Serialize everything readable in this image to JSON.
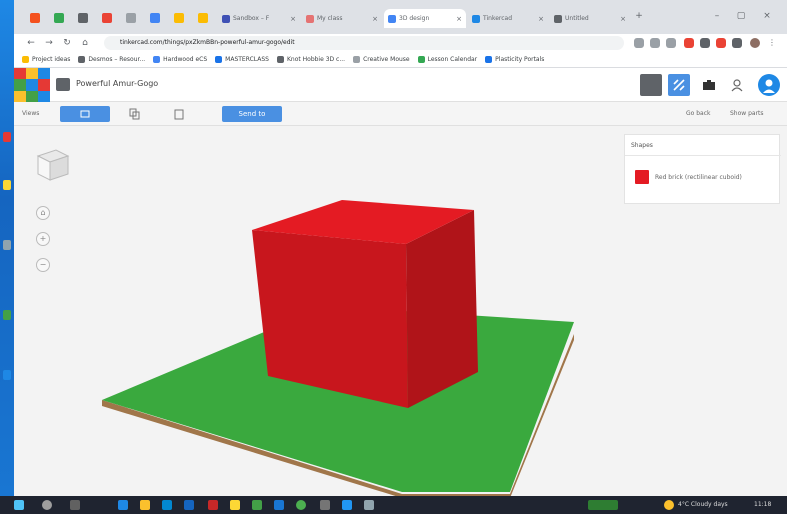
{
  "browser": {
    "tabs": [
      {
        "label": "Sandbox – F",
        "color": "#3f51b5"
      },
      {
        "label": "My class",
        "color": "#e57373"
      },
      {
        "label": "3D design",
        "color": "#4285f4",
        "active": true
      },
      {
        "label": "Tinkercad",
        "color": "#1e88e5"
      },
      {
        "label": "Untitled",
        "color": "#5f6368"
      }
    ],
    "url": "tinkercad.com/things/pxZkmBBn-powerful-amur-gogo/edit",
    "bookmarks": [
      {
        "label": "Project ideas",
        "color": "#fbbc04"
      },
      {
        "label": "Desmos – Resour...",
        "color": "#5f6368"
      },
      {
        "label": "Hardwood eCS",
        "color": "#4285f4"
      },
      {
        "label": "MASTERCLASS",
        "color": "#1a73e8"
      },
      {
        "label": "Knot Hobbie 3D c...",
        "color": "#5f6368"
      },
      {
        "label": "Creative Mouse",
        "color": "#9aa0a6"
      },
      {
        "label": "Lesson Calendar",
        "color": "#34a853"
      },
      {
        "label": "Plasticity Portals",
        "color": "#1a73e8"
      }
    ]
  },
  "app": {
    "title": "Powerful Amur-Gogo",
    "colors": {
      "accent": "#4a90e2",
      "primary": "#2a7ae2",
      "cube": "#e41b23",
      "plate": "#3aa93e",
      "plate_edge": "#a0764a"
    }
  },
  "toolbar": {
    "label": "Views",
    "send_label": "Send to",
    "right_links": [
      "Go back",
      "Show parts"
    ]
  },
  "props": {
    "title": "Shapes",
    "item_label": "Red brick (rectilinear cuboid)"
  },
  "taskbar": {
    "weather": "4°C Cloudy days",
    "time": "11:18"
  }
}
